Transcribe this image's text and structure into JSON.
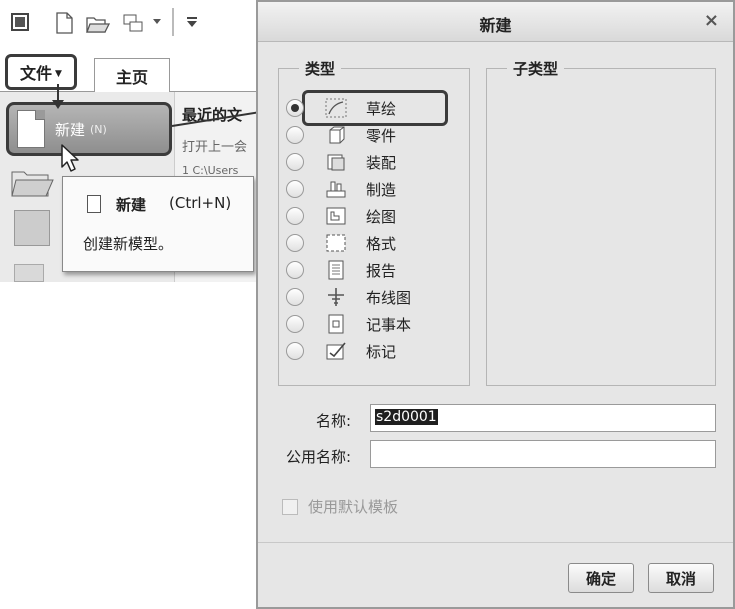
{
  "app": {
    "file_tab": "文件",
    "home_tab": "主页",
    "new_item_label": "新建",
    "new_item_accel": "(N)",
    "recent_title": "最近的文",
    "recent_sub": "打开上一会",
    "recent_path": "1 C:\\Users"
  },
  "tooltip": {
    "title": "新建",
    "shortcut": "(Ctrl+N)",
    "description": "创建新模型。"
  },
  "dialog": {
    "title": "新建",
    "close_glyph": "×",
    "type_group_label": "类型",
    "subtype_group_label": "子类型",
    "types": [
      {
        "label": "草绘",
        "icon": "sketch-icon",
        "selected": true
      },
      {
        "label": "零件",
        "icon": "part-icon",
        "selected": false
      },
      {
        "label": "装配",
        "icon": "assembly-icon",
        "selected": false
      },
      {
        "label": "制造",
        "icon": "manufacturing-icon",
        "selected": false
      },
      {
        "label": "绘图",
        "icon": "drawing-icon",
        "selected": false
      },
      {
        "label": "格式",
        "icon": "format-icon",
        "selected": false
      },
      {
        "label": "报告",
        "icon": "report-icon",
        "selected": false
      },
      {
        "label": "布线图",
        "icon": "diagram-icon",
        "selected": false
      },
      {
        "label": "记事本",
        "icon": "notebook-icon",
        "selected": false
      },
      {
        "label": "标记",
        "icon": "markup-icon",
        "selected": false
      }
    ],
    "name_label": "名称:",
    "name_value": "s2d0001",
    "common_name_label": "公用名称:",
    "common_name_value": "",
    "use_default_template_label": "使用默认模板",
    "use_default_template_checked": false,
    "ok_label": "确定",
    "cancel_label": "取消"
  }
}
